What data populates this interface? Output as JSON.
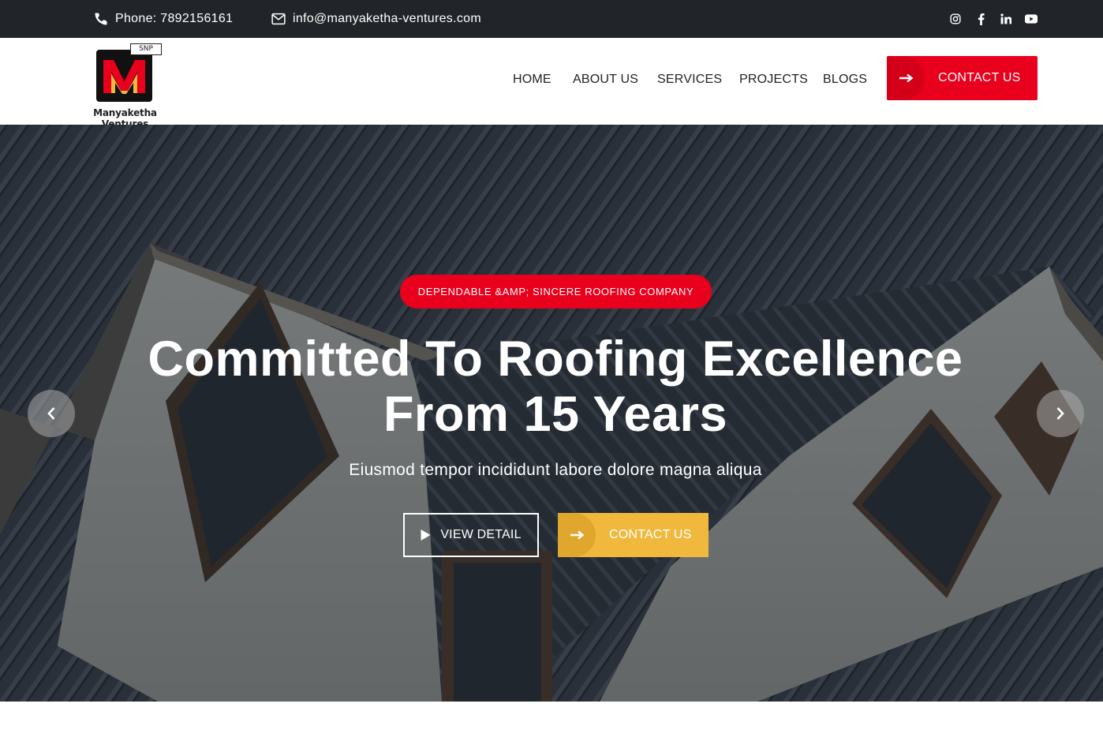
{
  "topbar": {
    "phone": "Phone: 7892156161",
    "email": "info@manyaketha-ventures.com",
    "social": [
      "instagram-icon",
      "facebook-icon",
      "linkedin-icon",
      "youtube-icon"
    ]
  },
  "header": {
    "logo_badge": "SNP",
    "logo_text": "Manyaketha Ventures",
    "nav": [
      "HOME",
      "ABOUT US",
      "SERVICES",
      "PROJECTS",
      "BLOGS"
    ],
    "cta_label": "CONTACT US"
  },
  "hero": {
    "badge": "DEPENDABLE &AMP; SINCERE ROOFING COMPANY",
    "title_line1": "Committed To Roofing Excellence",
    "title_line2": "From 15 Years",
    "subtitle": "Eiusmod tempor incididunt labore dolore magna aliqua",
    "view_detail_label": "VIEW DETAIL",
    "contact_label": "CONTACT US"
  },
  "colors": {
    "topbar_bg": "#212529",
    "primary_red": "#e8001c",
    "accent_yellow": "#f0b93e",
    "text_dark": "#222222"
  }
}
